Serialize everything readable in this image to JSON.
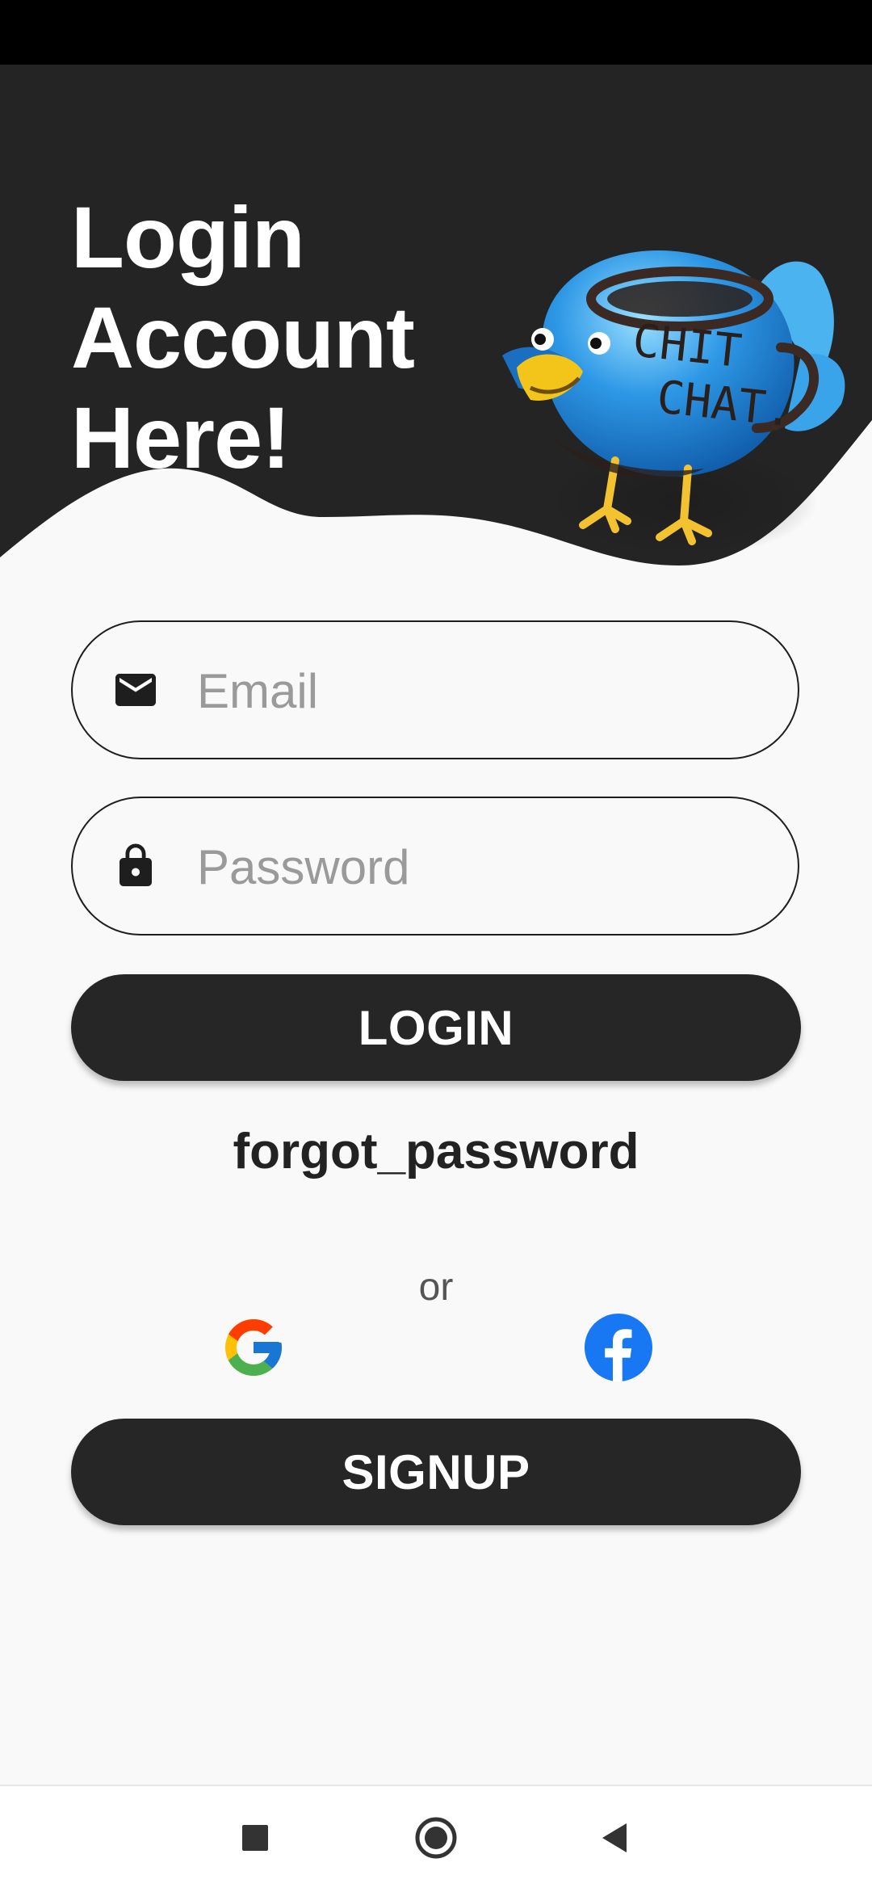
{
  "header": {
    "title_lines": [
      "Login",
      "Account",
      "Here!"
    ],
    "mascot_text": [
      "CHIT",
      "CHAT."
    ]
  },
  "form": {
    "email": {
      "icon": "mail-icon",
      "placeholder": "Email",
      "value": ""
    },
    "password": {
      "icon": "lock-icon",
      "placeholder": "Password",
      "value": ""
    },
    "login_label": "LOGIN",
    "forgot_label": "forgot_password",
    "or_label": "or",
    "signup_label": "SIGNUP"
  },
  "social": [
    {
      "name": "google",
      "icon": "google-icon"
    },
    {
      "name": "facebook",
      "icon": "facebook-icon"
    }
  ],
  "nav": {
    "buttons": [
      "recents-square-icon",
      "home-circle-icon",
      "back-triangle-icon"
    ]
  },
  "colors": {
    "header": "#242424",
    "background": "#f9f9f9",
    "button": "#262626",
    "bird_blue": "#2a8fe0",
    "facebook": "#1877f2"
  }
}
